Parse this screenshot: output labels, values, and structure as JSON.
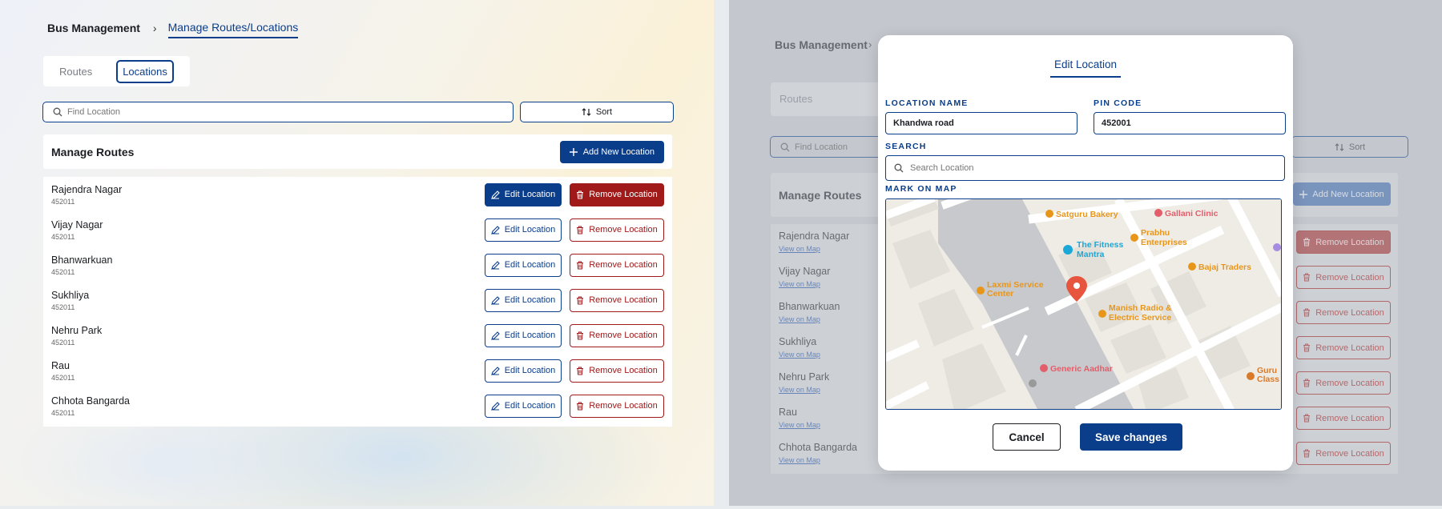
{
  "breadcrumb": {
    "root": "Bus Management",
    "separator": "›",
    "current": "Manage Routes/Locations"
  },
  "tabs": [
    {
      "label": "Routes"
    },
    {
      "label": "Locations"
    }
  ],
  "search": {
    "placeholder": "Find Location",
    "sort_label": "Sort"
  },
  "card": {
    "title": "Manage Routes",
    "add_label": "Add New Location"
  },
  "actions": {
    "edit_label": "Edit Location",
    "remove_label": "Remove Location",
    "view_map_label": "View on Map"
  },
  "locations": [
    {
      "name": "Rajendra Nagar",
      "pin": "452011"
    },
    {
      "name": "Vijay Nagar",
      "pin": "452011"
    },
    {
      "name": "Bhanwarkuan",
      "pin": "452011"
    },
    {
      "name": "Sukhliya",
      "pin": "452011"
    },
    {
      "name": "Nehru Park",
      "pin": "452011"
    },
    {
      "name": "Rau",
      "pin": "452011"
    },
    {
      "name": "Chhota Bangarda",
      "pin": "452011"
    }
  ],
  "modal": {
    "title": "Edit Location",
    "location_name_label": "LOCATION NAME",
    "location_name_value": "Khandwa road",
    "pin_label": "PIN CODE",
    "pin_value": "452001",
    "search_label": "SEARCH",
    "search_placeholder": "Search Location",
    "map_label": "MARK ON MAP",
    "cancel_label": "Cancel",
    "save_label": "Save changes",
    "map_places": {
      "satguru": "Satguru Bakery",
      "gallani": "Gallani Clinic",
      "prabhu1": "Prabhu",
      "prabhu2": "Enterprises",
      "fitness1": "The Fitness",
      "fitness2": "Mantra",
      "bajaj": "Bajaj Traders",
      "laxmi1": "Laxmi Service",
      "laxmi2": "Center",
      "manish1": "Manish Radio &",
      "manish2": "Electric Service",
      "aadhar": "Generic Aadhar",
      "guru1": "Guru",
      "guru2": "Class"
    }
  },
  "colors": {
    "primary": "#0a3d8a",
    "danger": "#a11a1a",
    "map_orange": "#e8961a",
    "map_pink": "#e35d6a",
    "map_cyan": "#1ba8d8"
  }
}
